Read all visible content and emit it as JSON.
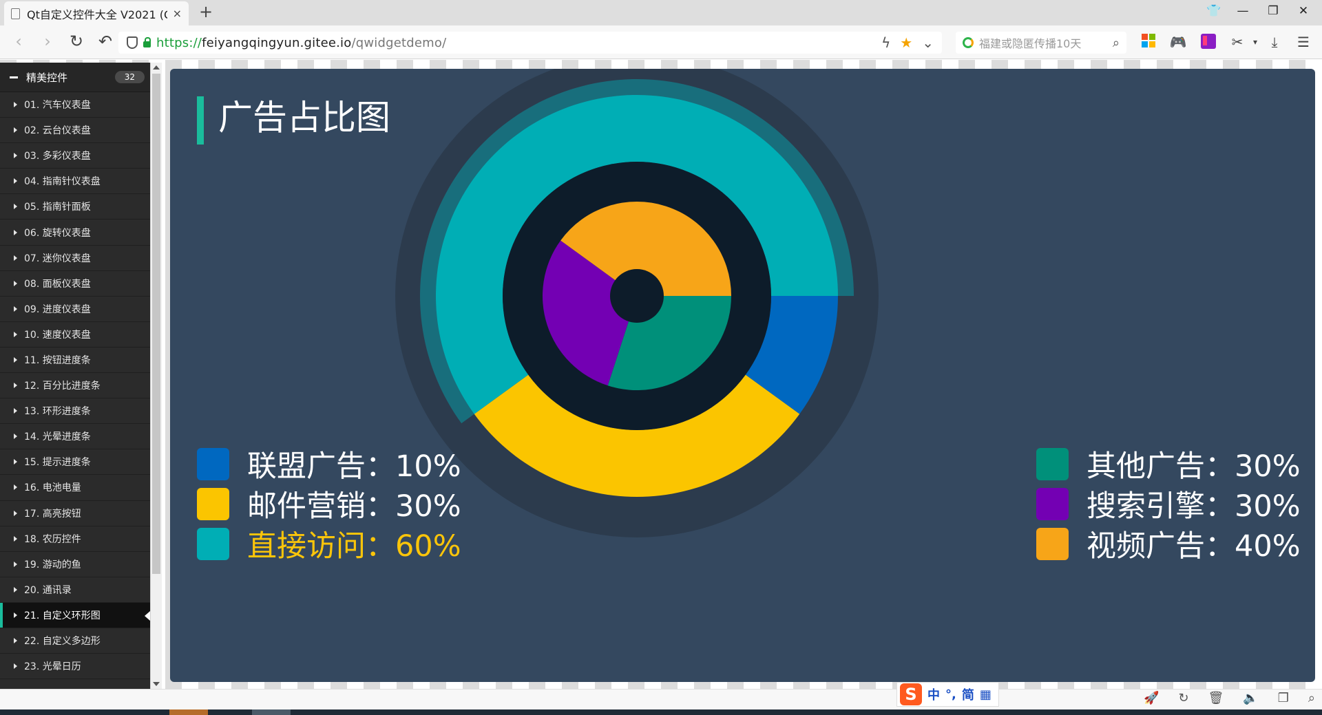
{
  "browser": {
    "tab_title": "Qt自定义控件大全 V2021 (Q",
    "tab_close": "×",
    "new_tab": "+",
    "url_scheme": "https://",
    "url_host": "feiyangqingyun.gitee.io",
    "url_path": "/qwidgetdemo/",
    "search_placeholder": "福建或隐匿传播10天"
  },
  "sidebar": {
    "group_title": "精美控件",
    "group_count": "32",
    "items": [
      "01. 汽车仪表盘",
      "02. 云台仪表盘",
      "03. 多彩仪表盘",
      "04. 指南针仪表盘",
      "05. 指南针面板",
      "06. 旋转仪表盘",
      "07. 迷你仪表盘",
      "08. 面板仪表盘",
      "09. 进度仪表盘",
      "10. 速度仪表盘",
      "11. 按钮进度条",
      "12. 百分比进度条",
      "13. 环形进度条",
      "14. 光晕进度条",
      "15. 提示进度条",
      "16. 电池电量",
      "17. 高亮按钮",
      "18. 农历控件",
      "19. 游动的鱼",
      "20. 通讯录",
      "21. 自定义环形图",
      "22. 自定义多边形",
      "23. 光晕日历"
    ],
    "selected_index": 20
  },
  "panel": {
    "title": "广告占比图",
    "accent_color": "#1abc9c",
    "background_color": "#34485f"
  },
  "chart_data": {
    "type": "pie",
    "outer_ring": {
      "slices": [
        {
          "name": "联盟广告",
          "value": 10,
          "color": "#0068c0"
        },
        {
          "name": "邮件营销",
          "value": 30,
          "color": "#fbc500"
        },
        {
          "name": "直接访问",
          "value": 60,
          "color": "#00aeb5"
        }
      ]
    },
    "inner_ring": {
      "slices": [
        {
          "name": "其他广告",
          "value": 30,
          "color": "#00907a"
        },
        {
          "name": "搜索引擎",
          "value": 30,
          "color": "#7300b3"
        },
        {
          "name": "视频广告",
          "value": 40,
          "color": "#f7a518"
        }
      ]
    },
    "highlighted": "直接访问",
    "legend": {
      "left": [
        {
          "label": "联盟广告：10%",
          "color": "#0068c0",
          "highlight": false
        },
        {
          "label": "邮件营销：30%",
          "color": "#fbc500",
          "highlight": false
        },
        {
          "label": "直接访问：60%",
          "color": "#00aeb5",
          "highlight": true
        }
      ],
      "right": [
        {
          "label": "其他广告：30%",
          "color": "#00907a",
          "highlight": false
        },
        {
          "label": "搜索引擎：30%",
          "color": "#7300b3",
          "highlight": false
        },
        {
          "label": "视频广告：40%",
          "color": "#f7a518",
          "highlight": false
        }
      ]
    }
  },
  "ime": {
    "logo": "S",
    "mode": "中",
    "punct": "°,",
    "script": "简"
  }
}
